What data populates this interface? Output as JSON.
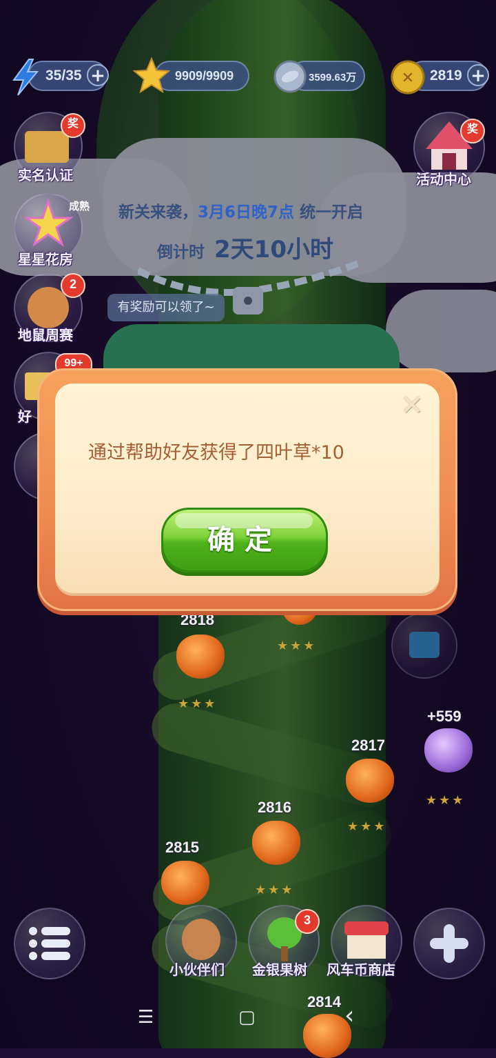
{
  "resources": [
    {
      "icon": "lightning-icon",
      "value": "35/35",
      "has_plus": true
    },
    {
      "icon": "star-icon",
      "value": "9909/9909",
      "has_plus": false
    },
    {
      "icon": "coin-icon",
      "value": "3599.63万",
      "has_plus": false
    },
    {
      "icon": "clover-coin-icon",
      "value": "2819",
      "has_plus": true
    }
  ],
  "side_menu": {
    "real_name": {
      "label": "实名认证",
      "tag": "奖"
    },
    "star_flower_house": {
      "label": "星星花房",
      "tag": "成熟"
    },
    "gopher_weekly": {
      "label": "地鼠周赛",
      "badge": "2"
    },
    "friends": {
      "label": "好",
      "badge": "99+"
    },
    "event_center": {
      "label": "活动中心",
      "tag": "奖"
    }
  },
  "announcement": {
    "line1_prefix": "新关来袭，",
    "line1_highlight": "3月6日晚7点",
    "line1_suffix": " 统一开启",
    "countdown_label": "倒计时",
    "countdown_value": "2天10小时"
  },
  "tooltip": "有奖励可以领了~",
  "levels": [
    {
      "number": "2818"
    },
    {
      "number": "2817"
    },
    {
      "number": "2816"
    },
    {
      "number": "2815"
    },
    {
      "number": "2814"
    }
  ],
  "bonus_label": "+559",
  "bottom_nav": {
    "partners": {
      "label": "小伙伴们"
    },
    "gold_silver_tree": {
      "label": "金银果树",
      "badge": "3"
    },
    "windmill_shop": {
      "label": "风车币商店"
    }
  },
  "dialog": {
    "message": "通过帮助好友获得了四叶草*10",
    "confirm_label": "确定",
    "close_glyph": "✕"
  },
  "system_nav": {
    "menu": "☰",
    "home": "▢",
    "back": "‹"
  }
}
